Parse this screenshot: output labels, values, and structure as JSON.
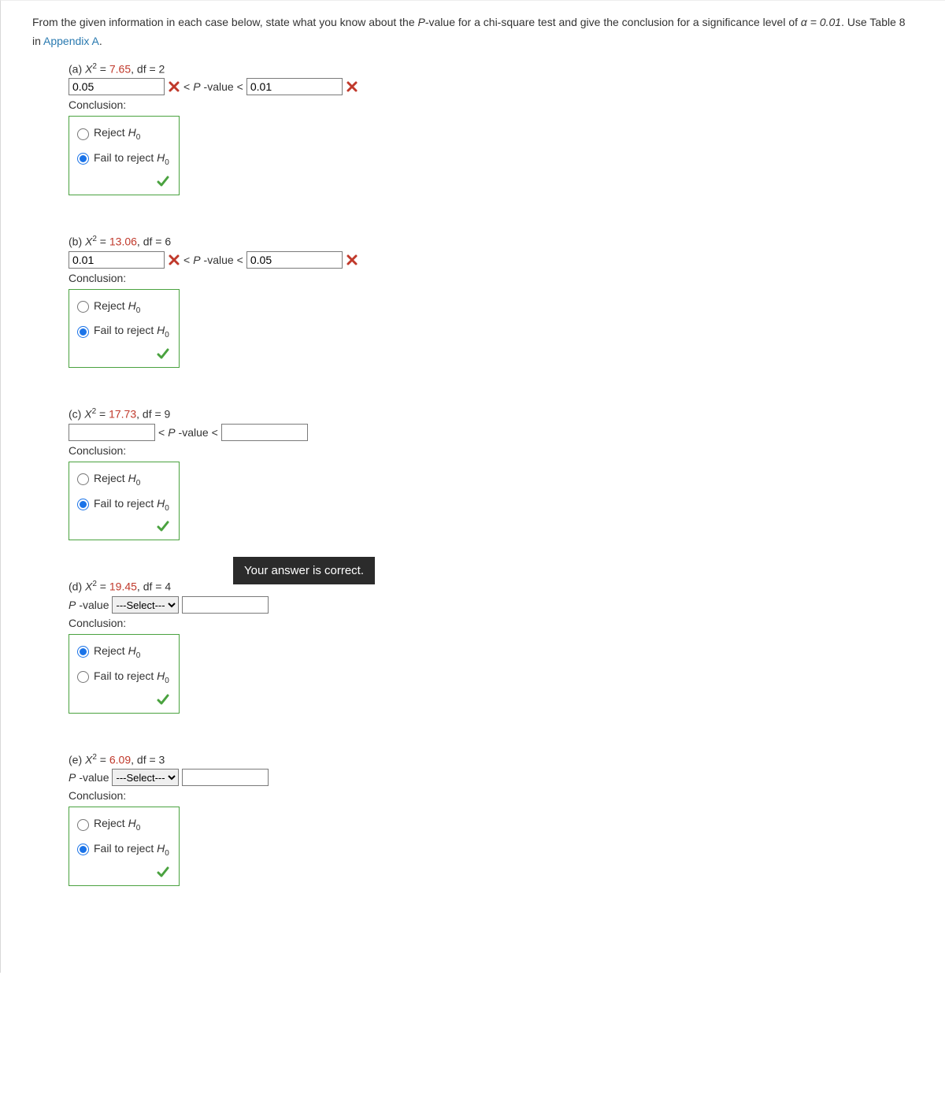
{
  "intro": {
    "part1": "From the given information in each case below, state what you know about the ",
    "pval": "P",
    "part2": "-value for a chi-square test and give the conclusion for a significance level of ",
    "alpha": "α = 0.01",
    "part3": ". Use Table 8 in ",
    "link": "Appendix A",
    "part4": "."
  },
  "labels": {
    "pvalue_lt": " < ",
    "pvalue_word": "-value",
    "conclusion": "Conclusion:",
    "reject": "Reject ",
    "fail": "Fail to reject ",
    "H": "H",
    "zero": "0",
    "select_placeholder": "---Select---",
    "pvalue_prefix": "-value "
  },
  "tooltip": "Your answer is correct.",
  "parts": {
    "a": {
      "label": "(a) ",
      "chi": "X",
      "sq": "2",
      "eq": " = ",
      "val": "7.65",
      "df": ", df = 2",
      "in1": "0.05",
      "in2": "0.01",
      "sel": "fail",
      "wrong": true
    },
    "b": {
      "label": "(b) ",
      "chi": "X",
      "sq": "2",
      "eq": " = ",
      "val": "13.06",
      "df": ", df = 6",
      "in1": "0.01",
      "in2": "0.05",
      "sel": "fail",
      "wrong": true
    },
    "c": {
      "label": "(c) ",
      "chi": "X",
      "sq": "2",
      "eq": " = ",
      "val": "17.73",
      "df": ", df = 9",
      "in1": "",
      "in2": "",
      "sel": "fail",
      "wrong": false
    },
    "d": {
      "label": "(d) ",
      "chi": "X",
      "sq": "2",
      "eq": " = ",
      "val": "19.45",
      "df": ", df = 4",
      "sel": "reject"
    },
    "e": {
      "label": "(e) ",
      "chi": "X",
      "sq": "2",
      "eq": " = ",
      "val": "6.09",
      "df": ", df = 3",
      "sel": "fail"
    }
  }
}
